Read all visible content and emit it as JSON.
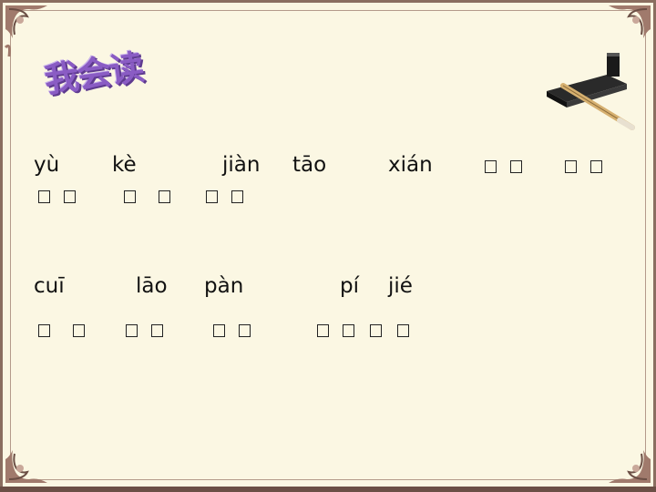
{
  "title": "我会读",
  "icons": [
    "corner-ornament-icon",
    "brush-inkstone-icon"
  ],
  "colors": {
    "background": "#fbf7e3",
    "title": "#8a5cc4",
    "frame": "#8a6e60",
    "text": "#111111"
  },
  "row1": {
    "pinyin": [
      "yù",
      "kè",
      "jiàn",
      "tāo",
      "xián"
    ],
    "hanzi_placeholders": [
      "□□",
      "□□",
      "□□",
      "□□",
      "□□"
    ]
  },
  "row2": {
    "pinyin": [
      "cuī",
      "lāo",
      "pàn",
      "pí",
      "jié"
    ],
    "hanzi_placeholders": [
      "□□",
      "□□",
      "□□",
      "□□□□"
    ]
  }
}
